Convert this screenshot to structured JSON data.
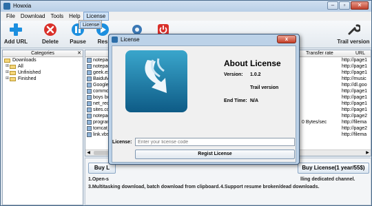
{
  "window": {
    "title": "Howxia"
  },
  "menu": {
    "items": [
      "File",
      "Download",
      "Tools",
      "Help",
      "License"
    ],
    "dropdown_item": "License"
  },
  "toolbar": {
    "add_url": "Add URL",
    "delete": "Delete",
    "pause": "Pause",
    "resume_partial": "Res",
    "trail_version": "Trail version"
  },
  "categories": {
    "header": "Categories",
    "close": "✕",
    "items": [
      "Downloads",
      "All",
      "Unfinished",
      "Finished"
    ]
  },
  "file_list": {
    "columns": {
      "transfer_rate": "Transfer rate",
      "url": "URL"
    },
    "rows": [
      {
        "name": "notepad",
        "rate": "",
        "url": "http://page1"
      },
      {
        "name": "notepad",
        "rate": "",
        "url": "http://page1"
      },
      {
        "name": "geek.ex",
        "rate": "",
        "url": "http://page1"
      },
      {
        "name": "BaiduM",
        "rate": "",
        "url": "http://music"
      },
      {
        "name": "Google",
        "rate": "",
        "url": "http://dl.goo"
      },
      {
        "name": "commo",
        "rate": "",
        "url": "http://page1"
      },
      {
        "name": "boys bo",
        "rate": "",
        "url": "http://page1"
      },
      {
        "name": "net_rec",
        "rate": "",
        "url": "http://page1"
      },
      {
        "name": "sites.co",
        "rate": "",
        "url": "http://page1"
      },
      {
        "name": "notepad",
        "rate": "",
        "url": "http://page2"
      },
      {
        "name": "program",
        "rate": "0 Bytes/sec",
        "url": "http://filema"
      },
      {
        "name": "tomcat_",
        "rate": "",
        "url": "http://page2"
      },
      {
        "name": "link.vbs",
        "rate": "",
        "url": "http://filema"
      }
    ]
  },
  "bottom": {
    "buy_left": "Buy L",
    "buy_right": "Buy License(1 year/55$)",
    "promo_1a": "1.Open-s",
    "promo_1b": "lling dedicated channel.",
    "promo_3": "3.Multitasking download, batch download from clipboard.",
    "promo_4": "4.Support resume broken/dead downloads."
  },
  "dialog": {
    "title": "License",
    "close": "x",
    "heading": "About License",
    "version_label": "Version:",
    "version_value": "1.0.2",
    "edition": "Trail version",
    "end_time_label": "End Time:",
    "end_time_value": "N/A",
    "license_label": "License:",
    "license_placeholder": "Enter your license code",
    "register_button": "Regist License"
  },
  "colors": {
    "logo_top": "#3aa6cc",
    "logo_bottom": "#0e5b86",
    "add_icon": "#1c8fdf",
    "delete_icon": "#d9302a"
  }
}
